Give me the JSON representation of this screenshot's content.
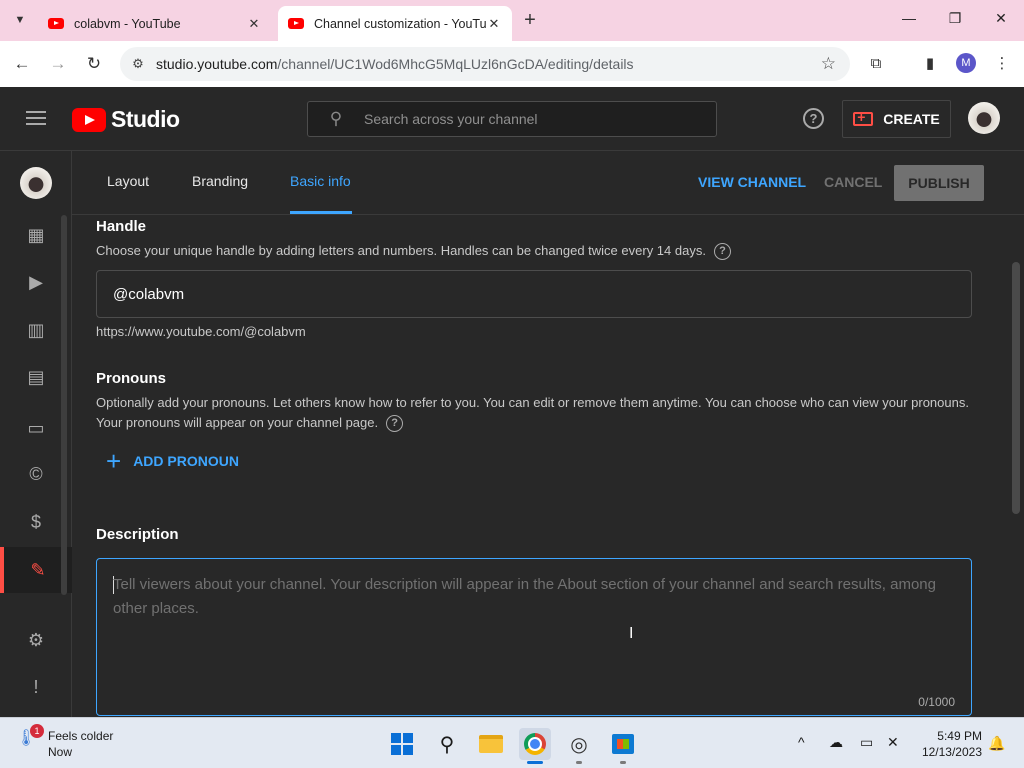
{
  "browser": {
    "tabs": [
      {
        "title": "colabvm - YouTube",
        "active": false
      },
      {
        "title": "Channel customization - YouTube Studio",
        "active": true
      }
    ],
    "url_host": "studio.youtube.com",
    "url_path": "/channel/UC1Wod6MhcG5MqLUzl6nGcDA/editing/details",
    "profile_initial": "M"
  },
  "studio": {
    "logo_text": "Studio",
    "search_placeholder": "Search across your channel",
    "create_label": "CREATE"
  },
  "customization": {
    "tabs": [
      "Layout",
      "Branding",
      "Basic info"
    ],
    "active_tab": "Basic info",
    "view_channel_label": "VIEW CHANNEL",
    "cancel_label": "CANCEL",
    "publish_label": "PUBLISH"
  },
  "handle": {
    "title": "Handle",
    "description": "Choose your unique handle by adding letters and numbers. Handles can be changed twice every 14 days.",
    "value": "@colabvm",
    "url": "https://www.youtube.com/@colabvm"
  },
  "pronouns": {
    "title": "Pronouns",
    "description_line1": "Optionally add your pronouns. Let others know how to refer to you. You can edit or remove them anytime. You can choose who can view your pronouns.",
    "description_line2": "Your pronouns will appear on your channel page.",
    "add_label": "ADD PRONOUN"
  },
  "description": {
    "title": "Description",
    "placeholder": "Tell viewers about your channel. Your description will appear in the About section of your channel and search results, among other places.",
    "counter": "0/1000"
  },
  "taskbar": {
    "weather_badge": "1",
    "weather_line1": "Feels colder",
    "weather_line2": "Now",
    "time": "5:49 PM",
    "date": "12/13/2023"
  },
  "colors": {
    "accent": "#3ea6ff",
    "studio_bg": "#282828",
    "brand_red": "#ff0000",
    "tabstrip": "#f6d3e3"
  }
}
